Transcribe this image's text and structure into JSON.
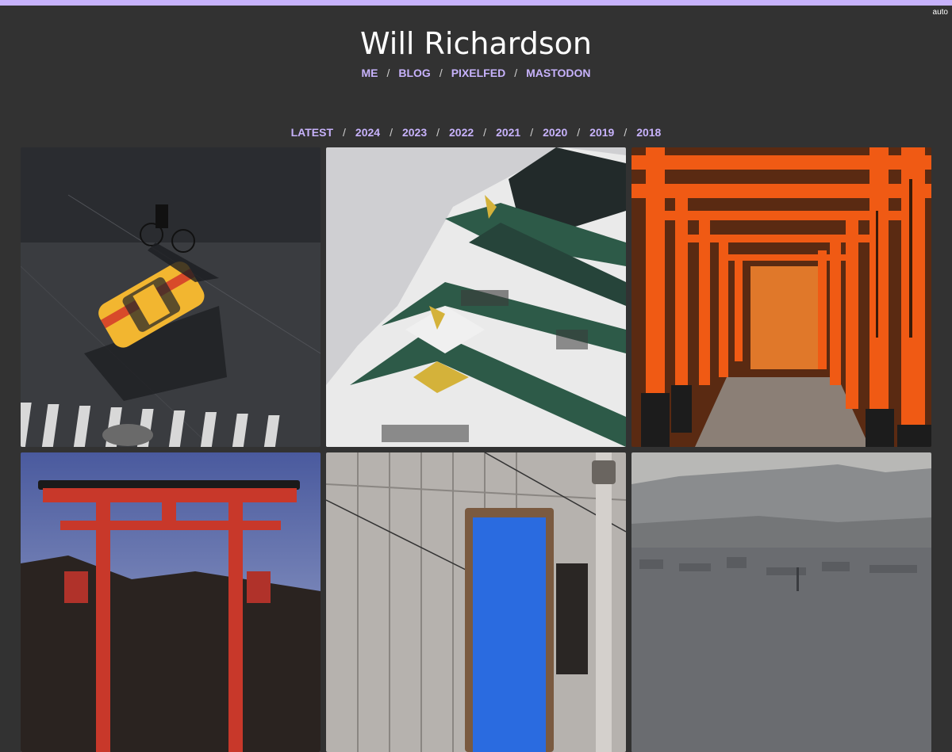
{
  "theme_toggle": "auto",
  "header": {
    "title": "Will Richardson",
    "links": [
      "ME",
      "BLOG",
      "PIXELFED",
      "MASTODON"
    ]
  },
  "filters": [
    "LATEST",
    "2024",
    "2023",
    "2022",
    "2021",
    "2020",
    "2019",
    "2018"
  ],
  "colors": {
    "accent": "#c7b2fb",
    "background": "#323232",
    "title": "#ffffff"
  }
}
